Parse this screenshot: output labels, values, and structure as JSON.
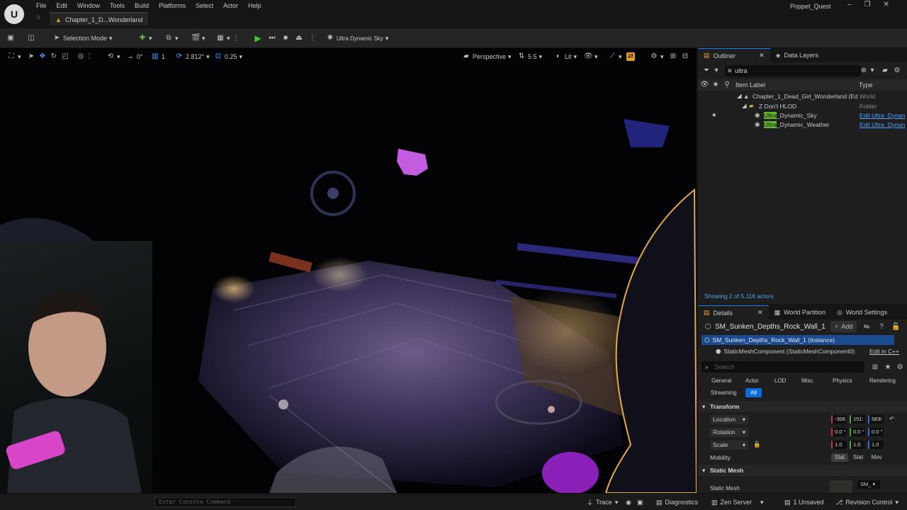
{
  "menubar": {
    "items": [
      "File",
      "Edit",
      "Window",
      "Tools",
      "Build",
      "Platforms",
      "Select",
      "Actor",
      "Help"
    ],
    "map_tab": "Chapter_1_D...Wonderland",
    "project_name": "Poppet_Quest"
  },
  "toolbar": {
    "selection_mode": "Selection Mode",
    "sky_label": "Ultra Dynamic Sky"
  },
  "viewport": {
    "rotation_snap": "0°",
    "scale_step": "1",
    "camera_speed": "2.812°",
    "snap_value": "0.25",
    "view_mode": "Perspective",
    "fov": "5.5",
    "lit": "Lit"
  },
  "outliner": {
    "tab_label": "Outliner",
    "second_tab": "Data Layers",
    "search_value": "ultra",
    "col_label": "Item Label",
    "col_type": "Type",
    "rows": [
      {
        "label": "Chapter_1_Dead_Girl_Wonderland (Edi",
        "type": "World"
      },
      {
        "label": "Z Don't HLOD",
        "type": "Folder"
      },
      {
        "hl": "Ultra",
        "rest": "_Dynamic_Sky",
        "type": "Edit Ultra_Dynan"
      },
      {
        "hl": "Ultra",
        "rest": "_Dynamic_Weather",
        "type": "Edit Ultra_Dynan"
      }
    ],
    "footer": "Showing 2 of 5,116 actors"
  },
  "details": {
    "tabs": [
      "Details",
      "World Partition",
      "World Settings"
    ],
    "actor_name": "SM_Sunken_Depths_Rock_Wall_1",
    "add_label": "Add",
    "selected_instance": "SM_Sunken_Depths_Rock_Wall_1 (Instance)",
    "component": "StaticMeshComponent (StaticMeshComponent0)",
    "edit_cpp": "Edit in C++",
    "search_placeholder": "Search",
    "categories": [
      "General",
      "Actor",
      "LOD",
      "Misc",
      "Physics",
      "Rendering",
      "Streaming",
      "All"
    ],
    "transform_label": "Transform",
    "location_label": "Location",
    "rotation_label": "Rotation",
    "scale_label": "Scale",
    "mobility_label": "Mobility",
    "location": [
      "-306",
      "151:",
      "583!"
    ],
    "rotation": [
      "0.0 °",
      "0.0 °",
      "0.0 °"
    ],
    "scale": [
      "1.0",
      "1.0",
      "1.0"
    ],
    "mobility_options": [
      "Stat",
      "Stat",
      "Mov"
    ],
    "static_mesh_section": "Static Mesh",
    "static_mesh_label": "Static Mesh",
    "static_mesh_value": "SM_"
  },
  "statusbar": {
    "console_placeholder": "Enter Console Command",
    "trace": "Trace",
    "diagnostics": "Diagnostics",
    "zen_server": "Zen Server",
    "unsaved": "1 Unsaved",
    "revision_control": "Revision Control"
  },
  "colors": {
    "accent": "#0a6de0",
    "highlight": "#63b62f",
    "selection_outline": "#e6a84a",
    "link": "#4fa3ff"
  }
}
